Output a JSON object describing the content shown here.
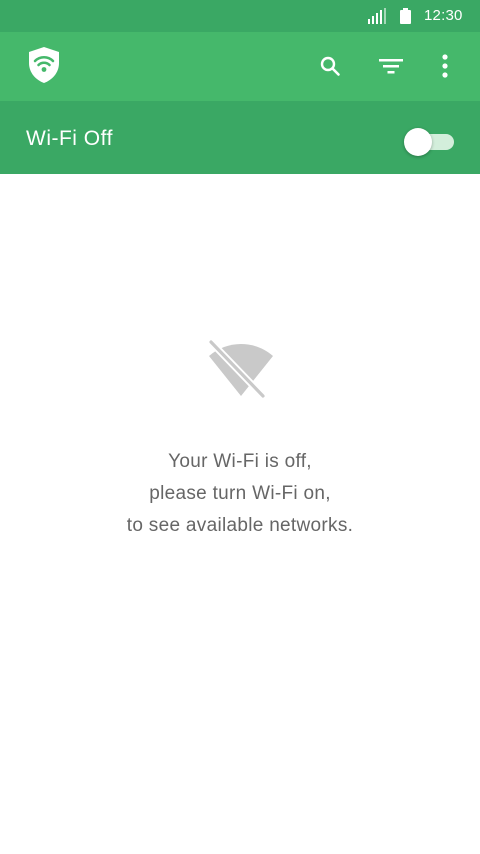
{
  "status_bar": {
    "time": "12:30",
    "signal_icon": "signal-icon",
    "battery_icon": "battery-icon"
  },
  "app_bar": {
    "logo_icon": "wifi-shield-logo-icon",
    "actions": [
      {
        "name": "search",
        "icon": "search-icon"
      },
      {
        "name": "filter",
        "icon": "filter-icon"
      },
      {
        "name": "overflow-menu",
        "icon": "more-vert-icon"
      }
    ]
  },
  "wifi_bar": {
    "title": "Wi-Fi Off",
    "toggle_on": false
  },
  "empty_state": {
    "icon": "wifi-off-icon",
    "lines": [
      "Your Wi-Fi is off,",
      "please turn Wi-Fi on,",
      "to see available networks."
    ]
  },
  "colors": {
    "status_bar": "#3aa864",
    "app_bar": "#45b86b",
    "wifi_bar": "#3aa864",
    "toggle_track": "#d3eedb",
    "toggle_thumb": "#ffffff",
    "message_text": "#666666",
    "icon_gray": "#c9c9c9"
  }
}
